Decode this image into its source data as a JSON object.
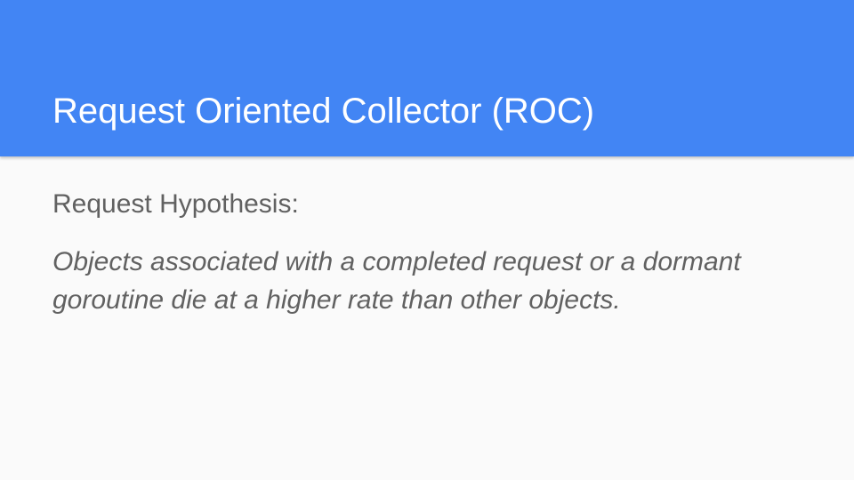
{
  "slide": {
    "title": "Request Oriented Collector (ROC)",
    "subheading": "Request Hypothesis:",
    "hypothesis_text": "Objects associated with a completed request or a dormant goroutine die at a higher rate than other objects."
  },
  "colors": {
    "header_background": "#4285f4",
    "slide_background": "#fafafa",
    "title_text": "#ffffff",
    "body_text": "#616161"
  }
}
